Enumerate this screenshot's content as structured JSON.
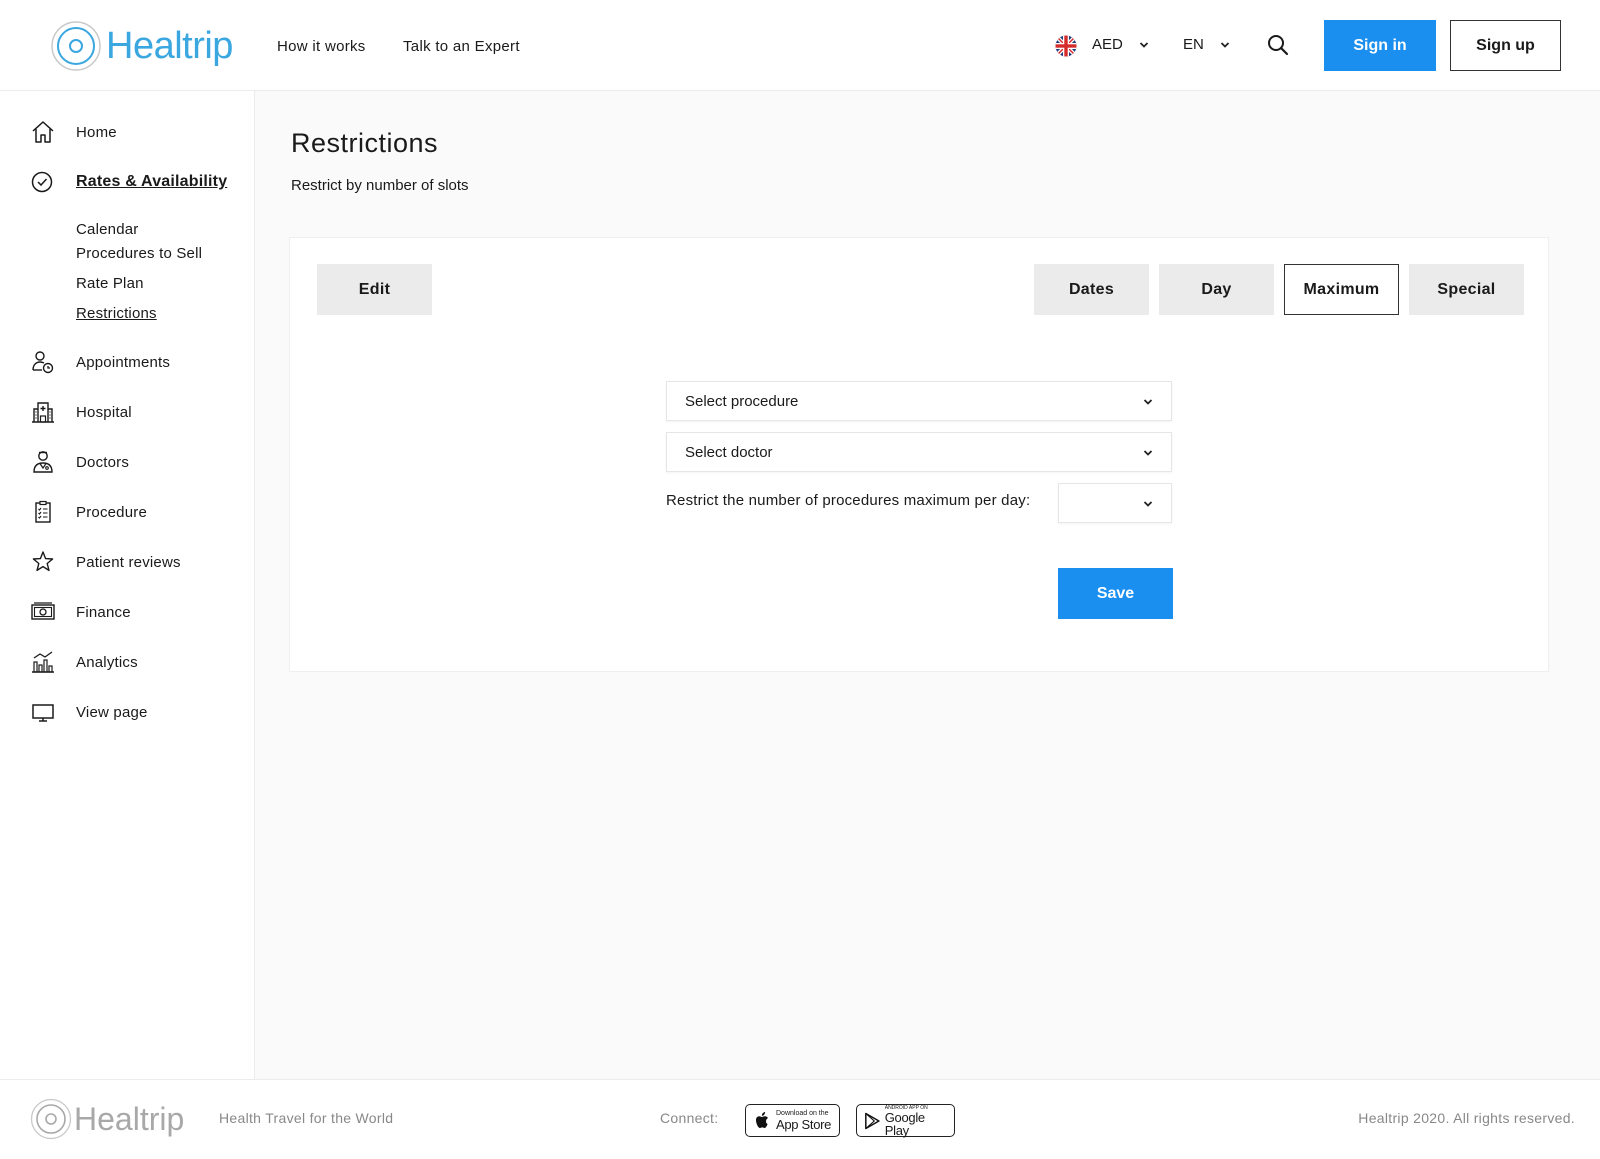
{
  "header": {
    "brand": "Healtrip",
    "nav": [
      "How it works",
      "Talk to an Expert"
    ],
    "currency": "AED",
    "language": "EN",
    "sign_in": "Sign in",
    "sign_up": "Sign up"
  },
  "sidebar": {
    "items": [
      {
        "label": "Home",
        "icon": "home-icon"
      },
      {
        "label": "Rates & Availability",
        "icon": "check-circle-icon",
        "active": true
      },
      {
        "label": "Appointments",
        "icon": "user-clock-icon"
      },
      {
        "label": "Hospital",
        "icon": "hospital-icon"
      },
      {
        "label": "Doctors",
        "icon": "doctor-icon"
      },
      {
        "label": "Procedure",
        "icon": "clipboard-icon"
      },
      {
        "label": "Patient reviews",
        "icon": "star-icon"
      },
      {
        "label": "Finance",
        "icon": "money-icon"
      },
      {
        "label": "Analytics",
        "icon": "analytics-icon"
      },
      {
        "label": "View page",
        "icon": "monitor-icon"
      }
    ],
    "subitems": [
      "Calendar",
      "Procedures to Sell",
      "Rate Plan",
      "Restrictions"
    ]
  },
  "main": {
    "title": "Restrictions",
    "subtitle": "Restrict by number of slots",
    "edit_tab": "Edit",
    "tabs": [
      "Dates",
      "Day",
      "Maximum",
      "Special"
    ],
    "selected_tab": "Maximum",
    "procedure_select": "Select procedure",
    "doctor_select": "Select doctor",
    "restrict_label": "Restrict the number of procedures maximum per day:",
    "max_per_day_value": "",
    "save": "Save"
  },
  "footer": {
    "brand": "Healtrip",
    "tagline": "Health Travel for the World",
    "connect": "Connect:",
    "app_store_small": "Download on the",
    "app_store_big": "App Store",
    "google_play_small": "ANDROID APP ON",
    "google_play_big": "Google Play",
    "copyright": "Healtrip 2020. All rights reserved."
  },
  "colors": {
    "brand_blue": "#3ba7e0",
    "primary_button": "#1a8ff0"
  }
}
